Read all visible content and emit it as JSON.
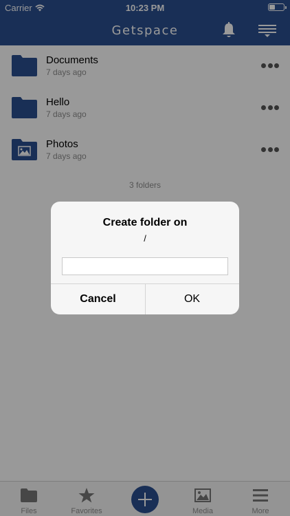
{
  "status_bar": {
    "carrier": "Carrier",
    "time": "10:23 PM",
    "battery_level": 0.4
  },
  "app": {
    "logo_text": "Getspace",
    "brand_color": "#2a4f8f"
  },
  "nav": {
    "bell_icon": "bell-icon",
    "menu_icon": "menu-icon"
  },
  "folders": [
    {
      "name": "Documents",
      "modified": "7 days ago",
      "icon": "folder-icon"
    },
    {
      "name": "Hello",
      "modified": "7 days ago",
      "icon": "folder-icon"
    },
    {
      "name": "Photos",
      "modified": "7 days ago",
      "icon": "folder-image-icon"
    }
  ],
  "folder_count": "3 folders",
  "tab_bar": {
    "tabs": [
      {
        "label": "Files",
        "icon": "folder-icon"
      },
      {
        "label": "Favorites",
        "icon": "star-icon"
      },
      {
        "label": "",
        "icon": "plus-icon"
      },
      {
        "label": "Media",
        "icon": "image-icon"
      },
      {
        "label": "More",
        "icon": "hamburger-icon"
      }
    ]
  },
  "dialog": {
    "title": "Create folder on",
    "path": "/",
    "input_value": "",
    "input_placeholder": "",
    "cancel_label": "Cancel",
    "ok_label": "OK"
  }
}
